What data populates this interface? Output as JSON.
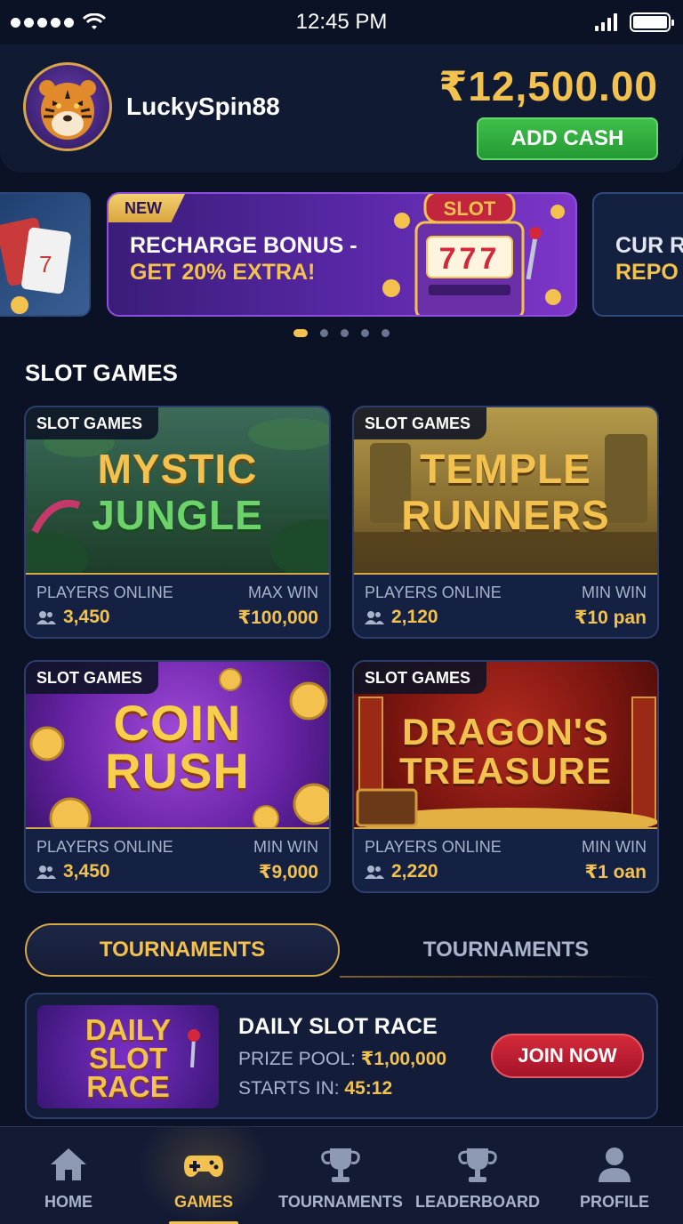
{
  "status_bar": {
    "time": "12:45 PM"
  },
  "header": {
    "username": "LuckySpin88",
    "balance": "₹12,500.00",
    "add_cash_label": "ADD CASH"
  },
  "carousel": {
    "main": {
      "badge": "NEW",
      "line1": "RECHARGE BONUS -",
      "line2": "GET 20% EXTRA!",
      "slot_sign": "SLOT",
      "reels": "777"
    },
    "right_peek": {
      "line1": "CUR R",
      "line2": "REPO"
    },
    "active_index": 0,
    "count": 5
  },
  "section_title": "SLOT GAMES",
  "games": [
    {
      "tag": "SLOT GAMES",
      "title1": "MYSTIC",
      "title2": "JUNGLE",
      "left_label": "PLAYERS ONLINE",
      "left_value": "3,450",
      "right_label": "MAX WIN",
      "right_value": "₹100,000"
    },
    {
      "tag": "SLOT GAMES",
      "title1": "TEMPLE",
      "title2": "RUNNERS",
      "left_label": "PLAYERS ONLINE",
      "left_value": "2,120",
      "right_label": "MIN WIN",
      "right_value": "₹10 pan"
    },
    {
      "tag": "SLOT GAMES",
      "title1": "COIN",
      "title2": "RUSH",
      "left_label": "PLAYERS ONLINE",
      "left_value": "3,450",
      "right_label": "MIN WIN",
      "right_value": "₹9,000"
    },
    {
      "tag": "SLOT GAMES",
      "title1": "DRAGON'S",
      "title2": "TREASURE",
      "left_label": "PLAYERS ONLINE",
      "left_value": "2,220",
      "right_label": "MIN WIN",
      "right_value": "₹1 oan"
    }
  ],
  "tabs": {
    "active": "TOURNAMENTS",
    "inactive": "TOURNAMENTS"
  },
  "tournament": {
    "art_line1": "DAILY",
    "art_line2": "SLOT",
    "art_line3": "RACE",
    "title": "DAILY SLOT RACE",
    "prize_label": "PRIZE POOL:",
    "prize_value": "₹1,00,000",
    "starts_label": "STARTS IN:",
    "starts_value": "45:12",
    "join_label": "JOIN NOW"
  },
  "nav": [
    {
      "label": "HOME",
      "icon": "home-icon"
    },
    {
      "label": "GAMES",
      "icon": "gamepad-icon",
      "active": true
    },
    {
      "label": "TOURNAMENTS",
      "icon": "trophy-icon"
    },
    {
      "label": "LEADERBOARD",
      "icon": "trophy-icon"
    },
    {
      "label": "PROFILE",
      "icon": "user-icon"
    }
  ],
  "colors": {
    "gold": "#f2c14e",
    "green": "#3fbf4a",
    "red": "#d42a3a",
    "bg": "#0b1226"
  }
}
